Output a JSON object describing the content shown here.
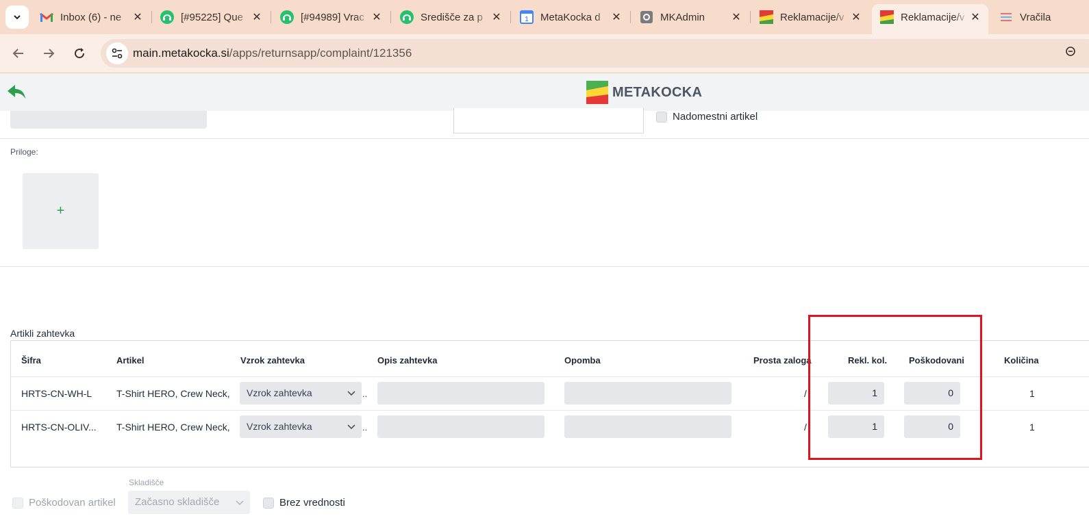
{
  "browser": {
    "tabs": [
      {
        "title": "Inbox (6) - ne",
        "icon": "gmail-icon"
      },
      {
        "title": "[#95225] Que",
        "icon": "freshdesk-icon"
      },
      {
        "title": "[#94989] Vrac",
        "icon": "freshdesk-icon"
      },
      {
        "title": "Središče za p",
        "icon": "freshdesk-icon"
      },
      {
        "title": "MetaKocka d",
        "icon": "calendar-icon"
      },
      {
        "title": "MKAdmin",
        "icon": "gear-icon"
      },
      {
        "title": "Reklamacije/v",
        "icon": "metakocka-icon"
      },
      {
        "title": "Reklamacije/v",
        "icon": "metakocka-icon"
      },
      {
        "title": "Vračila",
        "icon": "list-icon"
      }
    ],
    "url_host": "main.metakocka.si",
    "url_path": "/apps/returnsapp/complaint/121356"
  },
  "header": {
    "brand": "METAKOCKA"
  },
  "form": {
    "nadomestni_label": "Nadomestni artikel",
    "priloge_label": "Priloge:",
    "add_attachment": "+"
  },
  "items_section": {
    "title": "Artikli zahtevka",
    "columns": {
      "sifra": "Šifra",
      "artikel": "Artikel",
      "vzrok": "Vzrok zahtevka",
      "opis": "Opis zahtevka",
      "opomba": "Opomba",
      "prosta": "Prosta zaloga",
      "rekl": "Rekl. kol.",
      "posk": "Poškodovani",
      "kolicina": "Količina"
    },
    "rows": [
      {
        "sifra": "HRTS-CN-WH-L",
        "artikel": "T-Shirt HERO, Crew Neck,",
        "vzrok": "Vzrok zahtevka",
        "dots": "..",
        "prosta": "/",
        "rekl": "1",
        "posk": "0",
        "kolicina": "1"
      },
      {
        "sifra": "HRTS-CN-OLIV...",
        "artikel": "T-Shirt HERO, Crew Neck,",
        "vzrok": "Vzrok zahtevka",
        "dots": "..",
        "prosta": "/",
        "rekl": "1",
        "posk": "0",
        "kolicina": "1"
      }
    ]
  },
  "footer": {
    "poskodovan_label": "Poškodovan artikel",
    "skladisce_label": "Skladišče",
    "skladisce_value": "Začasno skladišče",
    "brez_label": "Brez vrednosti"
  },
  "colors": {
    "tabstrip": "#f7dccb",
    "accent_green": "#2e9e4f",
    "highlight_red": "#e0141e"
  }
}
